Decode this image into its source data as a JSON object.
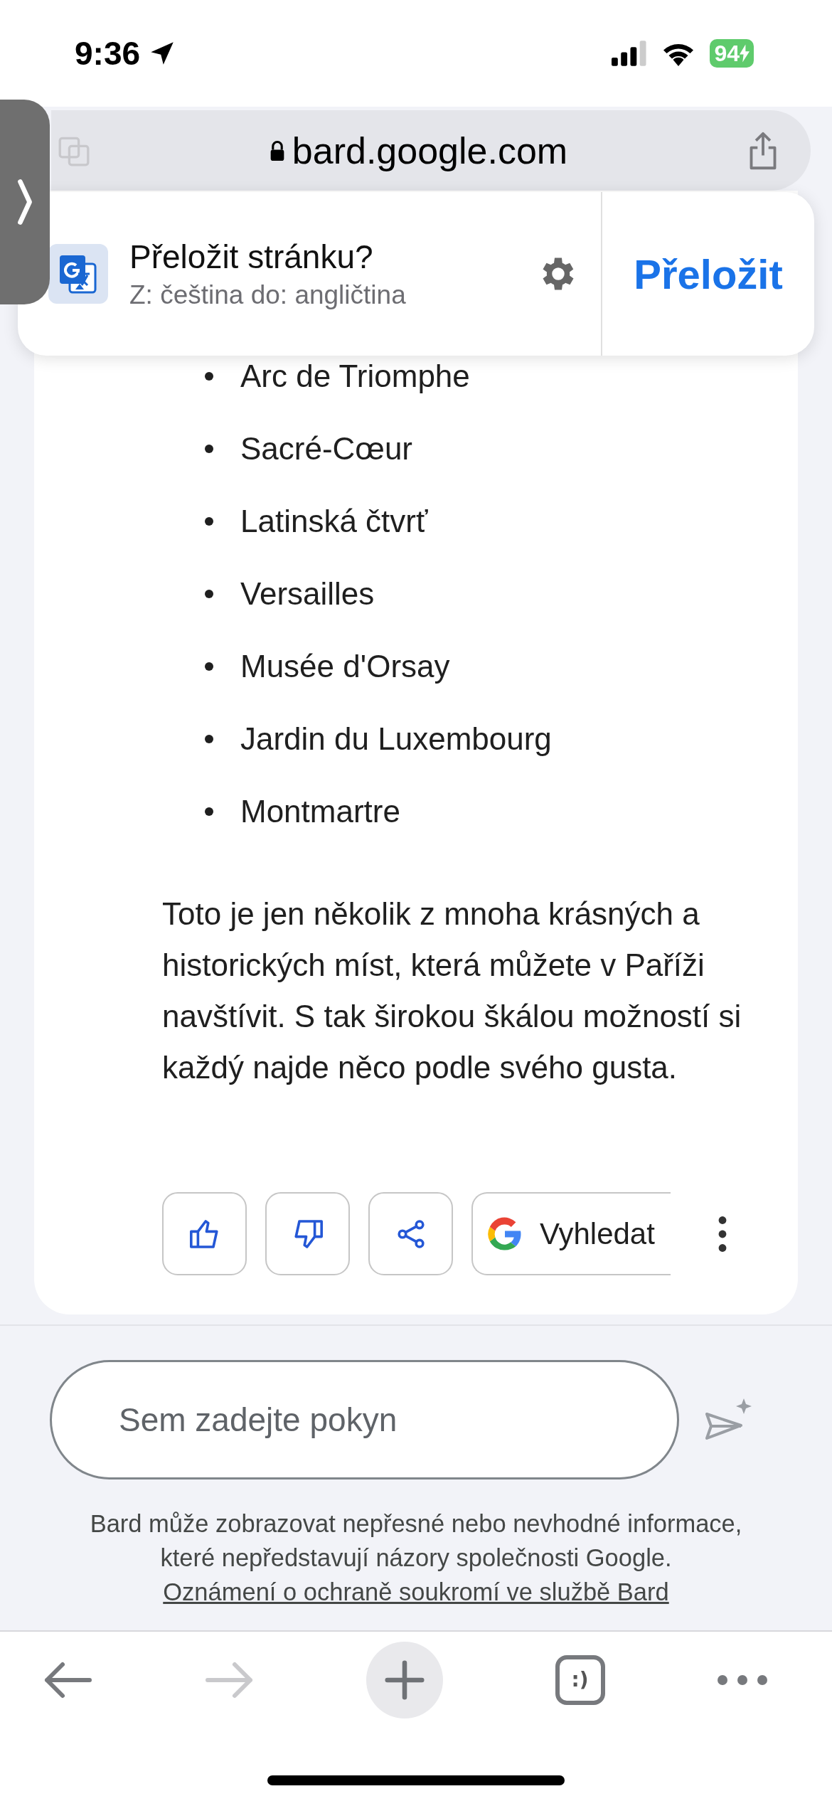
{
  "status_bar": {
    "time": "9:36",
    "battery": "94"
  },
  "address_bar": {
    "url": "bard.google.com"
  },
  "translate_prompt": {
    "title": "Přeložit stránku?",
    "subtitle": "Z: čeština do: angličtina",
    "action": "Přeložit"
  },
  "response": {
    "list_items": [
      "Arc de Triomphe",
      "Sacré-Cœur",
      "Latinská čtvrť",
      "Versailles",
      "Musée d'Orsay",
      "Jardin du Luxembourg",
      "Montmartre"
    ],
    "paragraph": "Toto je jen několik z mnoha krásných a historických míst, která můžete v Paříži navštívit. S tak širokou škálou možností si každý najde něco podle svého gusta.",
    "actions": [
      {
        "kind": "thumbs-up"
      },
      {
        "kind": "thumbs-down"
      },
      {
        "kind": "share"
      },
      {
        "kind": "google-search",
        "label": "Vyhledat"
      }
    ]
  },
  "composer": {
    "placeholder": "Sem zadejte pokyn"
  },
  "disclaimer": {
    "text": "Bard může zobrazovat nepřesné nebo nevhodné informace, které nepředstavují názory společnosti Google.",
    "link": "Oznámení o ochraně soukromí ve službě Bard"
  },
  "toolbar": {
    "tabs_icon_text": ":)"
  }
}
